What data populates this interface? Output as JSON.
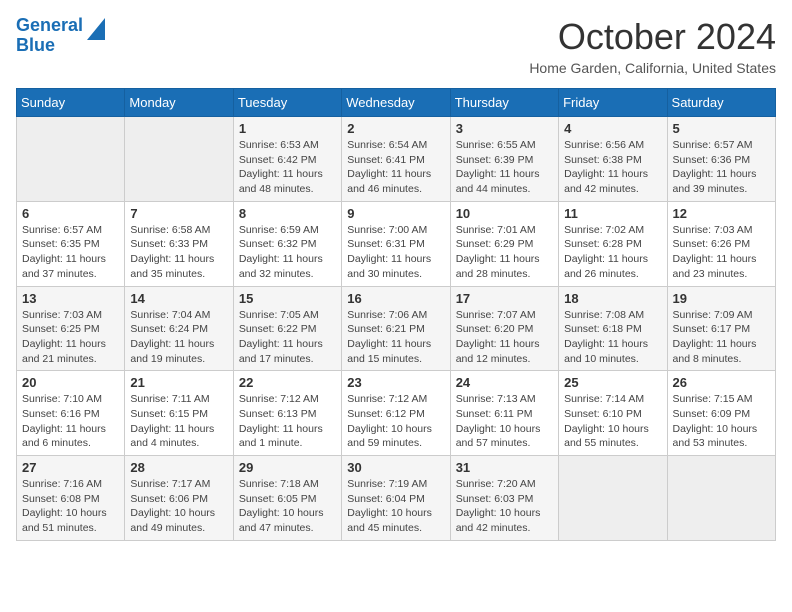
{
  "header": {
    "logo_line1": "General",
    "logo_line2": "Blue",
    "month": "October 2024",
    "location": "Home Garden, California, United States"
  },
  "days_of_week": [
    "Sunday",
    "Monday",
    "Tuesday",
    "Wednesday",
    "Thursday",
    "Friday",
    "Saturday"
  ],
  "weeks": [
    [
      {
        "num": "",
        "info": ""
      },
      {
        "num": "",
        "info": ""
      },
      {
        "num": "1",
        "info": "Sunrise: 6:53 AM\nSunset: 6:42 PM\nDaylight: 11 hours and 48 minutes."
      },
      {
        "num": "2",
        "info": "Sunrise: 6:54 AM\nSunset: 6:41 PM\nDaylight: 11 hours and 46 minutes."
      },
      {
        "num": "3",
        "info": "Sunrise: 6:55 AM\nSunset: 6:39 PM\nDaylight: 11 hours and 44 minutes."
      },
      {
        "num": "4",
        "info": "Sunrise: 6:56 AM\nSunset: 6:38 PM\nDaylight: 11 hours and 42 minutes."
      },
      {
        "num": "5",
        "info": "Sunrise: 6:57 AM\nSunset: 6:36 PM\nDaylight: 11 hours and 39 minutes."
      }
    ],
    [
      {
        "num": "6",
        "info": "Sunrise: 6:57 AM\nSunset: 6:35 PM\nDaylight: 11 hours and 37 minutes."
      },
      {
        "num": "7",
        "info": "Sunrise: 6:58 AM\nSunset: 6:33 PM\nDaylight: 11 hours and 35 minutes."
      },
      {
        "num": "8",
        "info": "Sunrise: 6:59 AM\nSunset: 6:32 PM\nDaylight: 11 hours and 32 minutes."
      },
      {
        "num": "9",
        "info": "Sunrise: 7:00 AM\nSunset: 6:31 PM\nDaylight: 11 hours and 30 minutes."
      },
      {
        "num": "10",
        "info": "Sunrise: 7:01 AM\nSunset: 6:29 PM\nDaylight: 11 hours and 28 minutes."
      },
      {
        "num": "11",
        "info": "Sunrise: 7:02 AM\nSunset: 6:28 PM\nDaylight: 11 hours and 26 minutes."
      },
      {
        "num": "12",
        "info": "Sunrise: 7:03 AM\nSunset: 6:26 PM\nDaylight: 11 hours and 23 minutes."
      }
    ],
    [
      {
        "num": "13",
        "info": "Sunrise: 7:03 AM\nSunset: 6:25 PM\nDaylight: 11 hours and 21 minutes."
      },
      {
        "num": "14",
        "info": "Sunrise: 7:04 AM\nSunset: 6:24 PM\nDaylight: 11 hours and 19 minutes."
      },
      {
        "num": "15",
        "info": "Sunrise: 7:05 AM\nSunset: 6:22 PM\nDaylight: 11 hours and 17 minutes."
      },
      {
        "num": "16",
        "info": "Sunrise: 7:06 AM\nSunset: 6:21 PM\nDaylight: 11 hours and 15 minutes."
      },
      {
        "num": "17",
        "info": "Sunrise: 7:07 AM\nSunset: 6:20 PM\nDaylight: 11 hours and 12 minutes."
      },
      {
        "num": "18",
        "info": "Sunrise: 7:08 AM\nSunset: 6:18 PM\nDaylight: 11 hours and 10 minutes."
      },
      {
        "num": "19",
        "info": "Sunrise: 7:09 AM\nSunset: 6:17 PM\nDaylight: 11 hours and 8 minutes."
      }
    ],
    [
      {
        "num": "20",
        "info": "Sunrise: 7:10 AM\nSunset: 6:16 PM\nDaylight: 11 hours and 6 minutes."
      },
      {
        "num": "21",
        "info": "Sunrise: 7:11 AM\nSunset: 6:15 PM\nDaylight: 11 hours and 4 minutes."
      },
      {
        "num": "22",
        "info": "Sunrise: 7:12 AM\nSunset: 6:13 PM\nDaylight: 11 hours and 1 minute."
      },
      {
        "num": "23",
        "info": "Sunrise: 7:12 AM\nSunset: 6:12 PM\nDaylight: 10 hours and 59 minutes."
      },
      {
        "num": "24",
        "info": "Sunrise: 7:13 AM\nSunset: 6:11 PM\nDaylight: 10 hours and 57 minutes."
      },
      {
        "num": "25",
        "info": "Sunrise: 7:14 AM\nSunset: 6:10 PM\nDaylight: 10 hours and 55 minutes."
      },
      {
        "num": "26",
        "info": "Sunrise: 7:15 AM\nSunset: 6:09 PM\nDaylight: 10 hours and 53 minutes."
      }
    ],
    [
      {
        "num": "27",
        "info": "Sunrise: 7:16 AM\nSunset: 6:08 PM\nDaylight: 10 hours and 51 minutes."
      },
      {
        "num": "28",
        "info": "Sunrise: 7:17 AM\nSunset: 6:06 PM\nDaylight: 10 hours and 49 minutes."
      },
      {
        "num": "29",
        "info": "Sunrise: 7:18 AM\nSunset: 6:05 PM\nDaylight: 10 hours and 47 minutes."
      },
      {
        "num": "30",
        "info": "Sunrise: 7:19 AM\nSunset: 6:04 PM\nDaylight: 10 hours and 45 minutes."
      },
      {
        "num": "31",
        "info": "Sunrise: 7:20 AM\nSunset: 6:03 PM\nDaylight: 10 hours and 42 minutes."
      },
      {
        "num": "",
        "info": ""
      },
      {
        "num": "",
        "info": ""
      }
    ]
  ]
}
